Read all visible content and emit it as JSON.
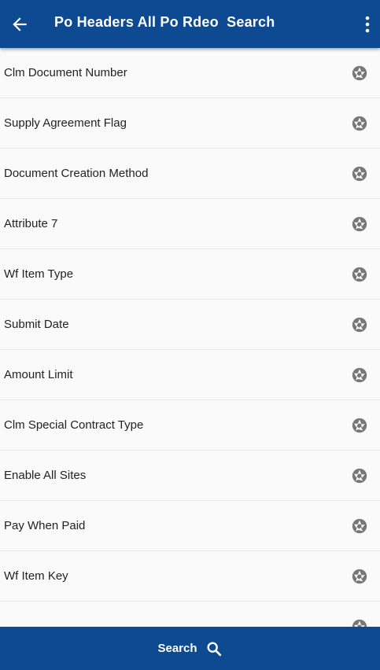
{
  "header": {
    "title": "Po Headers All Po Rdeo  Search",
    "back_icon": "arrow-left-icon",
    "menu_icon": "more-vert-icon",
    "background": "#0d4a92"
  },
  "list": {
    "items": [
      {
        "label": "Clm Document Number",
        "icon": "aperture-icon"
      },
      {
        "label": "Supply Agreement Flag",
        "icon": "aperture-icon"
      },
      {
        "label": "Document Creation Method",
        "icon": "aperture-icon"
      },
      {
        "label": "Attribute 7",
        "icon": "aperture-icon"
      },
      {
        "label": "Wf Item Type",
        "icon": "aperture-icon"
      },
      {
        "label": "Submit Date",
        "icon": "aperture-icon"
      },
      {
        "label": "Amount Limit",
        "icon": "aperture-icon"
      },
      {
        "label": "Clm Special Contract Type",
        "icon": "aperture-icon"
      },
      {
        "label": "Enable All Sites",
        "icon": "aperture-icon"
      },
      {
        "label": "Pay When Paid",
        "icon": "aperture-icon"
      },
      {
        "label": "Wf Item Key",
        "icon": "aperture-icon"
      },
      {
        "label": "",
        "icon": "aperture-icon"
      }
    ]
  },
  "footer": {
    "search_label": "Search",
    "search_icon": "search-icon"
  }
}
